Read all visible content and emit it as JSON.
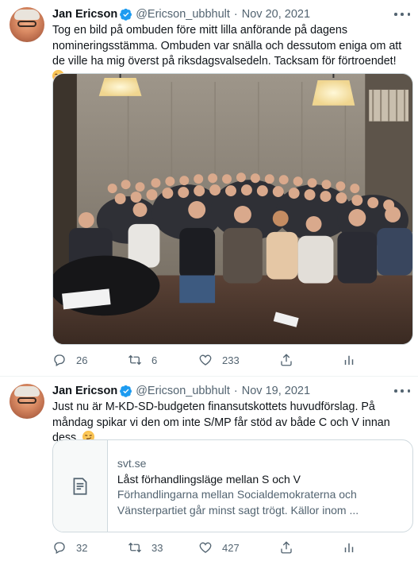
{
  "tweets": [
    {
      "author": "Jan Ericson",
      "handle": "@Ericson_ubbhult",
      "date": "Nov 20, 2021",
      "text": "Tog en bild på ombuden före mitt lilla anförande på dagens nomineringsstämma. Ombuden var snälla och dessutom eniga om att de ville ha mig överst på riksdagsvalsedeln. Tacksam för förtroendet!",
      "emoji": "smiling-face-emoji",
      "replies": "26",
      "retweets": "6",
      "likes": "233"
    },
    {
      "author": "Jan Ericson",
      "handle": "@Ericson_ubbhult",
      "date": "Nov 19, 2021",
      "text": "Just nu är M-KD-SD-budgeten finansutskottets huvudförslag. På måndag spikar vi den om inte S/MP får stöd av både C och V innan dess.",
      "emoji": "smirking-face-emoji",
      "card": {
        "domain": "svt.se",
        "title": "Låst förhandlingsläge mellan S och V",
        "description": "Förhandlingarna mellan Socialdemokraterna och Vänsterpartiet går minst sagt trögt. Källor inom ..."
      },
      "replies": "32",
      "retweets": "33",
      "likes": "427"
    }
  ],
  "colors": {
    "verified": "#1d9bf0",
    "muted": "#536471",
    "text": "#0f1419",
    "border": "#cfd9de"
  }
}
